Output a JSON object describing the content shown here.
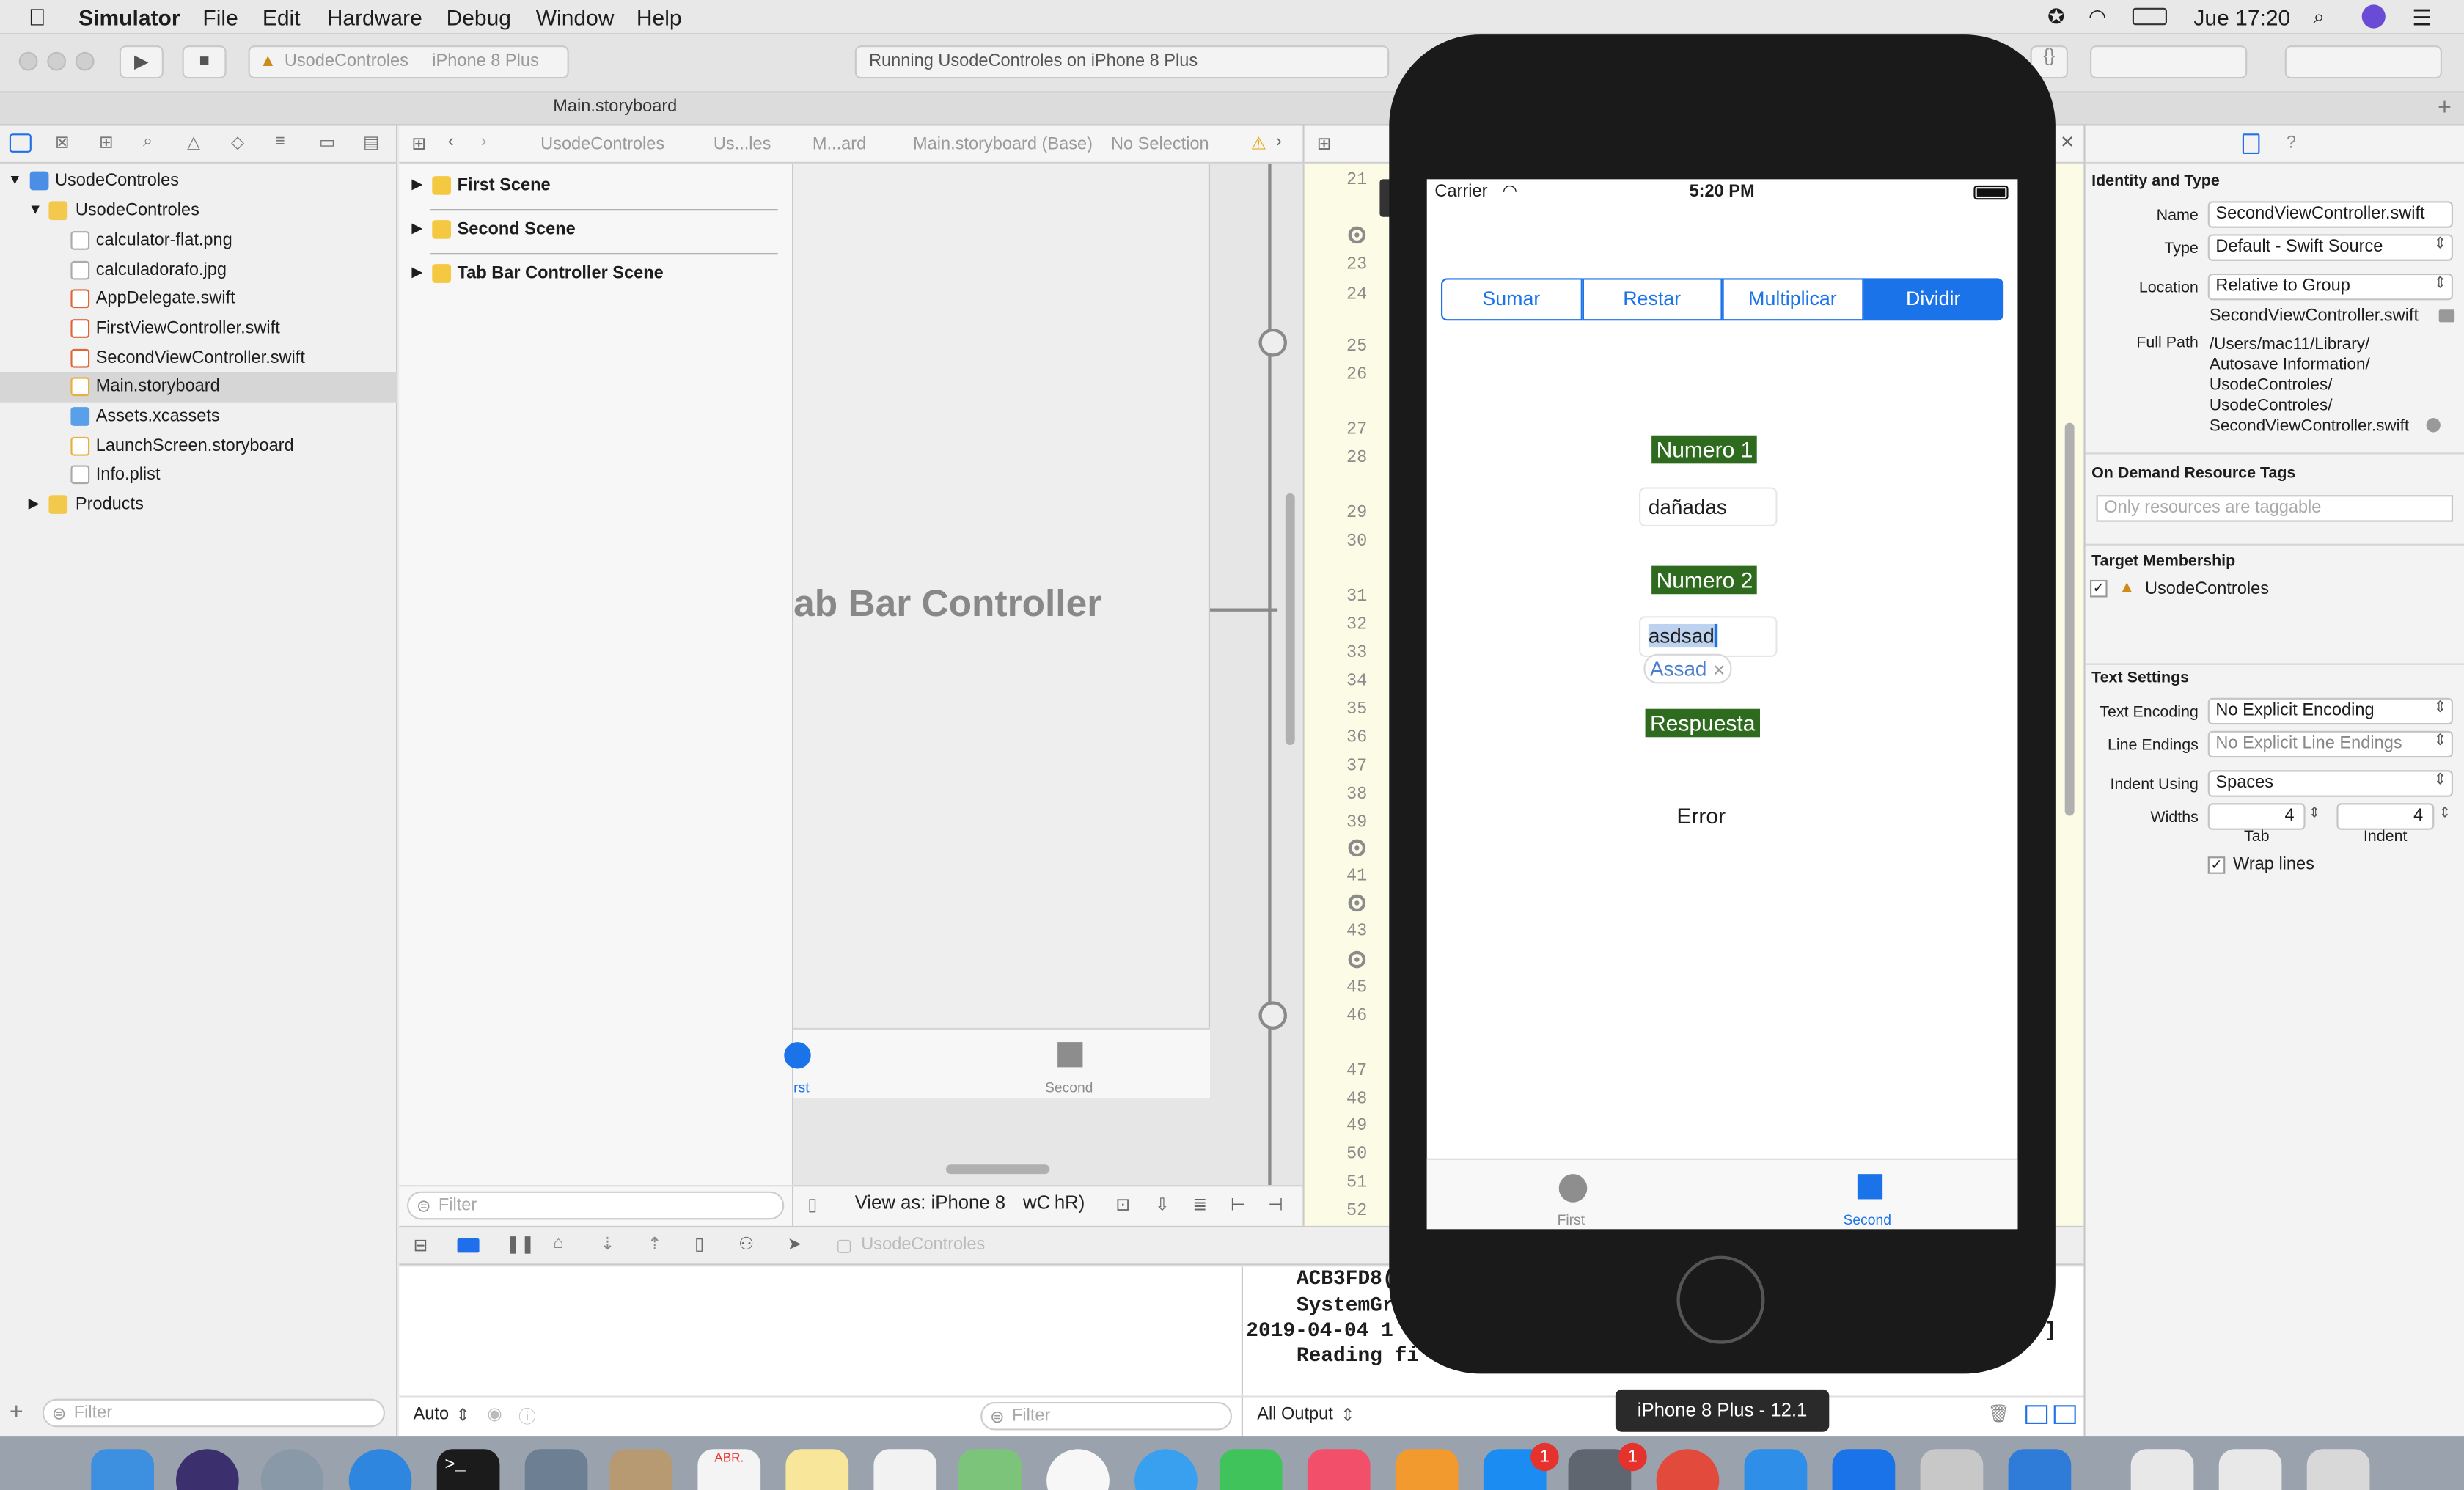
{
  "menubar": {
    "app_name": "Simulator",
    "menus": [
      "File",
      "Edit",
      "Hardware",
      "Debug",
      "Window",
      "Help"
    ],
    "clock": "Jue 17:20"
  },
  "toolbar": {
    "scheme": "UsodeControles",
    "device": "iPhone 8 Plus",
    "status": "Running UsodeControles on iPhone 8 Plus",
    "tab_title": "Main.storyboard"
  },
  "navigator": {
    "project": "UsodeControles",
    "group": "UsodeControles",
    "files": [
      "calculator-flat.png",
      "calculadorafo.jpg",
      "AppDelegate.swift",
      "FirstViewController.swift",
      "SecondViewController.swift",
      "Main.storyboard",
      "Assets.xcassets",
      "LaunchScreen.storyboard",
      "Info.plist"
    ],
    "products": "Products",
    "filter_placeholder": "Filter"
  },
  "jumpbar": {
    "crumbs": [
      "UsodeControles",
      "Us...les",
      "M...ard",
      "Main.storyboard (Base)",
      "No Selection"
    ]
  },
  "outline": {
    "scenes": [
      "First Scene",
      "Second Scene",
      "Tab Bar Controller Scene"
    ],
    "filter_placeholder": "Filter"
  },
  "canvas": {
    "title_fragment": "ab Bar Controller",
    "tab_first_fragment": "rst",
    "tab_second": "Second",
    "view_as": "View as: iPhone 8",
    "view_as_w": "wC",
    "view_as_h": "hR)"
  },
  "editor": {
    "line_numbers": [
      "21",
      "23",
      "24",
      "25",
      "26",
      "27",
      "28",
      "29",
      "30",
      "31",
      "32",
      "33",
      "34",
      "35",
      "36",
      "37",
      "38",
      "39",
      "41",
      "43",
      "45",
      "46",
      "47",
      "48",
      "49",
      "50",
      "51",
      "52"
    ]
  },
  "debug": {
    "target": "UsodeControles",
    "auto_label": "Auto",
    "filter_placeholder": "Filter",
    "output_label": "All Output",
    "console_lines": [
      "ACB3FD8(",
      "SystemGr",
      "2019-04-04 1",
      "Reading fi"
    ],
    "console_bracket": "]"
  },
  "inspector": {
    "identity_header": "Identity and Type",
    "name_label": "Name",
    "name_value": "SecondViewController.swift",
    "type_label": "Type",
    "type_value": "Default - Swift Source",
    "location_label": "Location",
    "location_value": "Relative to Group",
    "location_file": "SecondViewController.swift",
    "full_path_label": "Full Path",
    "full_path_lines": [
      "/Users/mac11/Library/",
      "Autosave Information/",
      "UsodeControles/",
      "UsodeControles/",
      "SecondViewController.swift"
    ],
    "odr_header": "On Demand Resource Tags",
    "odr_placeholder": "Only resources are taggable",
    "target_header": "Target Membership",
    "target_name": "UsodeControles",
    "text_header": "Text Settings",
    "encoding_label": "Text Encoding",
    "encoding_value": "No Explicit Encoding",
    "line_endings_label": "Line Endings",
    "line_endings_value": "No Explicit Line Endings",
    "indent_label": "Indent Using",
    "indent_value": "Spaces",
    "widths_label": "Widths",
    "tab_width": "4",
    "indent_width": "4",
    "tab_caption": "Tab",
    "indent_caption": "Indent",
    "wrap_label": "Wrap lines"
  },
  "simulator": {
    "carrier": "Carrier",
    "time": "5:20 PM",
    "segments": [
      "Sumar",
      "Restar",
      "Multiplicar",
      "Dividir"
    ],
    "selected_segment": 3,
    "numero1_label": "Numero 1",
    "numero1_value": "dañadas",
    "numero2_label": "Numero 2",
    "numero2_value": "asdsad",
    "suggestion": "Assad",
    "respuesta_label": "Respuesta",
    "result": "Error",
    "tab_first": "First",
    "tab_second": "Second",
    "device_tooltip": "iPhone 8 Plus - 12.1"
  },
  "dock": {
    "calendar_month": "ABR.",
    "badge_appstore": "1",
    "badge_prefs": "1"
  },
  "colors": {
    "accent": "#1a73e8",
    "label_green": "#2e6b1e",
    "xcode_blue": "#1f6feb"
  }
}
